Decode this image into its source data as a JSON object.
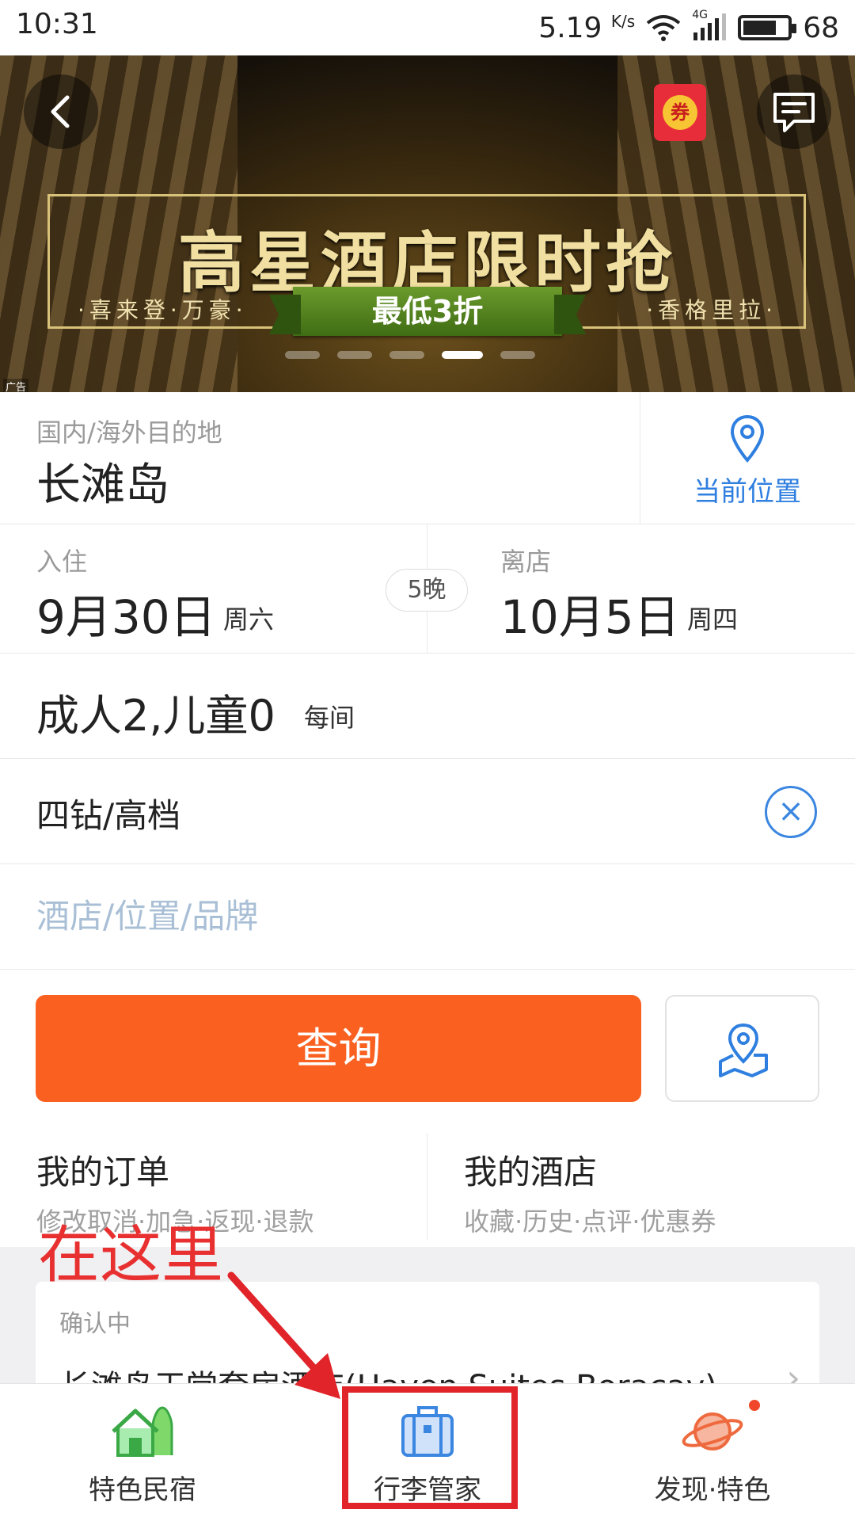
{
  "status_bar": {
    "time": "10:31",
    "speed": "5.19",
    "speed_unit": "K/s",
    "network": "4G",
    "battery": "68"
  },
  "banner": {
    "title": "高星酒店限时抢",
    "subtitle_left": "·喜来登·万豪·",
    "subtitle_right": "·香格里拉·",
    "ribbon": "最低3折",
    "ad_label": "广告",
    "coupon_label": "券",
    "slides": 5,
    "active_slide": 4
  },
  "destination": {
    "hint": "国内/海外目的地",
    "value": "长滩岛",
    "location_label": "当前位置"
  },
  "dates": {
    "checkin_label": "入住",
    "checkin_date": "9月30日",
    "checkin_weekday": "周六",
    "checkout_label": "离店",
    "checkout_date": "10月5日",
    "checkout_weekday": "周四",
    "nights": "5晚"
  },
  "guests": {
    "value": "成人2,儿童0",
    "unit": "每间"
  },
  "star": {
    "value": "四钻/高档"
  },
  "keyword": {
    "placeholder": "酒店/位置/品牌"
  },
  "search_button": "查询",
  "quick_links": [
    {
      "title": "我的订单",
      "subtitle": "修改取消·加急·返现·退款"
    },
    {
      "title": "我的酒店",
      "subtitle": "收藏·历史·点评·优惠券"
    }
  ],
  "order_card": {
    "status": "确认中",
    "name": "长滩岛天堂套房酒店(Haven Suites Boracay)"
  },
  "annotation": {
    "text": "在这里"
  },
  "tabbar": [
    {
      "label": "特色民宿",
      "icon": "house-icon"
    },
    {
      "label": "行李管家",
      "icon": "suitcase-icon"
    },
    {
      "label": "发现·特色",
      "icon": "planet-icon"
    }
  ],
  "colors": {
    "accent_blue": "#2f7fe0",
    "search_orange": "#fa6020",
    "annotation_red": "#e0242a"
  }
}
